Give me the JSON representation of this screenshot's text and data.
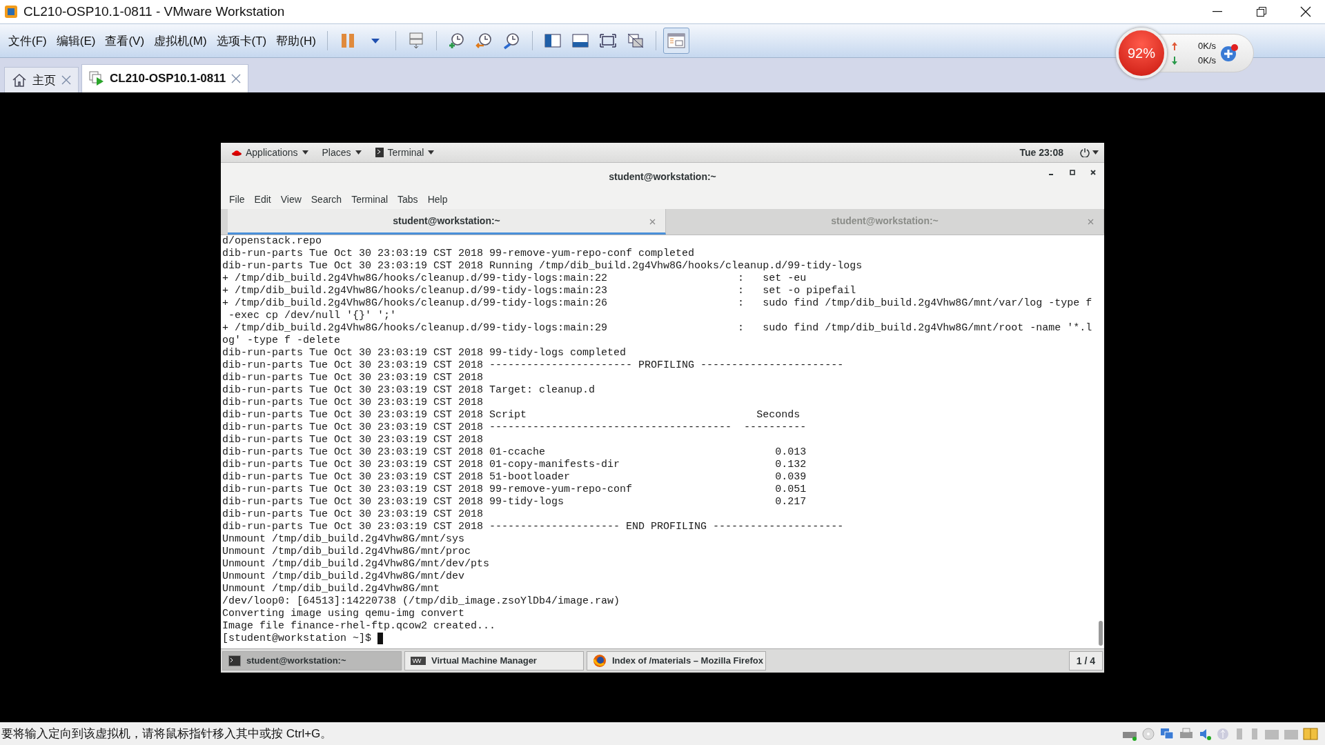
{
  "window": {
    "title": "CL210-OSP10.1-0811 - VMware Workstation"
  },
  "menu": [
    "文件(F)",
    "编辑(E)",
    "查看(V)",
    "虚拟机(M)",
    "选项卡(T)",
    "帮助(H)"
  ],
  "tabs": [
    {
      "label": "主页",
      "selected": false
    },
    {
      "label": "CL210-OSP10.1-0811",
      "selected": true
    }
  ],
  "network_widget": {
    "percent": "92%",
    "upload": "0K/s",
    "download": "0K/s"
  },
  "guest": {
    "top_bar": {
      "items": [
        "Applications",
        "Places",
        "Terminal"
      ],
      "clock": "Tue 23:08"
    },
    "terminal": {
      "title": "student@workstation:~",
      "menu": [
        "File",
        "Edit",
        "View",
        "Search",
        "Terminal",
        "Tabs",
        "Help"
      ],
      "tabs": [
        {
          "label": "student@workstation:~",
          "selected": true
        },
        {
          "label": "student@workstation:~",
          "selected": false
        }
      ],
      "lines": [
        "d/openstack.repo",
        "dib-run-parts Tue Oct 30 23:03:19 CST 2018 99-remove-yum-repo-conf completed",
        "dib-run-parts Tue Oct 30 23:03:19 CST 2018 Running /tmp/dib_build.2g4Vhw8G/hooks/cleanup.d/99-tidy-logs",
        "+ /tmp/dib_build.2g4Vhw8G/hooks/cleanup.d/99-tidy-logs:main:22                     :   set -eu",
        "+ /tmp/dib_build.2g4Vhw8G/hooks/cleanup.d/99-tidy-logs:main:23                     :   set -o pipefail",
        "+ /tmp/dib_build.2g4Vhw8G/hooks/cleanup.d/99-tidy-logs:main:26                     :   sudo find /tmp/dib_build.2g4Vhw8G/mnt/var/log -type f",
        " -exec cp /dev/null '{}' ';'",
        "+ /tmp/dib_build.2g4Vhw8G/hooks/cleanup.d/99-tidy-logs:main:29                     :   sudo find /tmp/dib_build.2g4Vhw8G/mnt/root -name '*.l",
        "og' -type f -delete",
        "dib-run-parts Tue Oct 30 23:03:19 CST 2018 99-tidy-logs completed",
        "dib-run-parts Tue Oct 30 23:03:19 CST 2018 ----------------------- PROFILING -----------------------",
        "dib-run-parts Tue Oct 30 23:03:19 CST 2018",
        "dib-run-parts Tue Oct 30 23:03:19 CST 2018 Target: cleanup.d",
        "dib-run-parts Tue Oct 30 23:03:19 CST 2018",
        "dib-run-parts Tue Oct 30 23:03:19 CST 2018 Script                                     Seconds",
        "dib-run-parts Tue Oct 30 23:03:19 CST 2018 ---------------------------------------  ----------",
        "dib-run-parts Tue Oct 30 23:03:19 CST 2018",
        "dib-run-parts Tue Oct 30 23:03:19 CST 2018 01-ccache                                     0.013",
        "dib-run-parts Tue Oct 30 23:03:19 CST 2018 01-copy-manifests-dir                         0.132",
        "dib-run-parts Tue Oct 30 23:03:19 CST 2018 51-bootloader                                 0.039",
        "dib-run-parts Tue Oct 30 23:03:19 CST 2018 99-remove-yum-repo-conf                       0.051",
        "dib-run-parts Tue Oct 30 23:03:19 CST 2018 99-tidy-logs                                  0.217",
        "dib-run-parts Tue Oct 30 23:03:19 CST 2018",
        "dib-run-parts Tue Oct 30 23:03:19 CST 2018 --------------------- END PROFILING ---------------------",
        "Unmount /tmp/dib_build.2g4Vhw8G/mnt/sys",
        "Unmount /tmp/dib_build.2g4Vhw8G/mnt/proc",
        "Unmount /tmp/dib_build.2g4Vhw8G/mnt/dev/pts",
        "Unmount /tmp/dib_build.2g4Vhw8G/mnt/dev",
        "Unmount /tmp/dib_build.2g4Vhw8G/mnt",
        "/dev/loop0: [64513]:14220738 (/tmp/dib_image.zsoYlDb4/image.raw)",
        "Converting image using qemu-img convert",
        "Image file finance-rhel-ftp.qcow2 created..."
      ],
      "prompt": "[student@workstation ~]$"
    },
    "taskbar": {
      "items": [
        {
          "kind": "terminal",
          "label": "student@workstation:~",
          "selected": true
        },
        {
          "kind": "vmm",
          "label": "Virtual Machine Manager",
          "selected": false
        },
        {
          "kind": "firefox",
          "label": "Index of /materials – Mozilla Firefox",
          "selected": false
        }
      ],
      "workspace": "1 / 4"
    }
  },
  "status_bar": {
    "message": "要将输入定向到该虚拟机，请将鼠标指针移入其中或按 Ctrl+G。"
  }
}
